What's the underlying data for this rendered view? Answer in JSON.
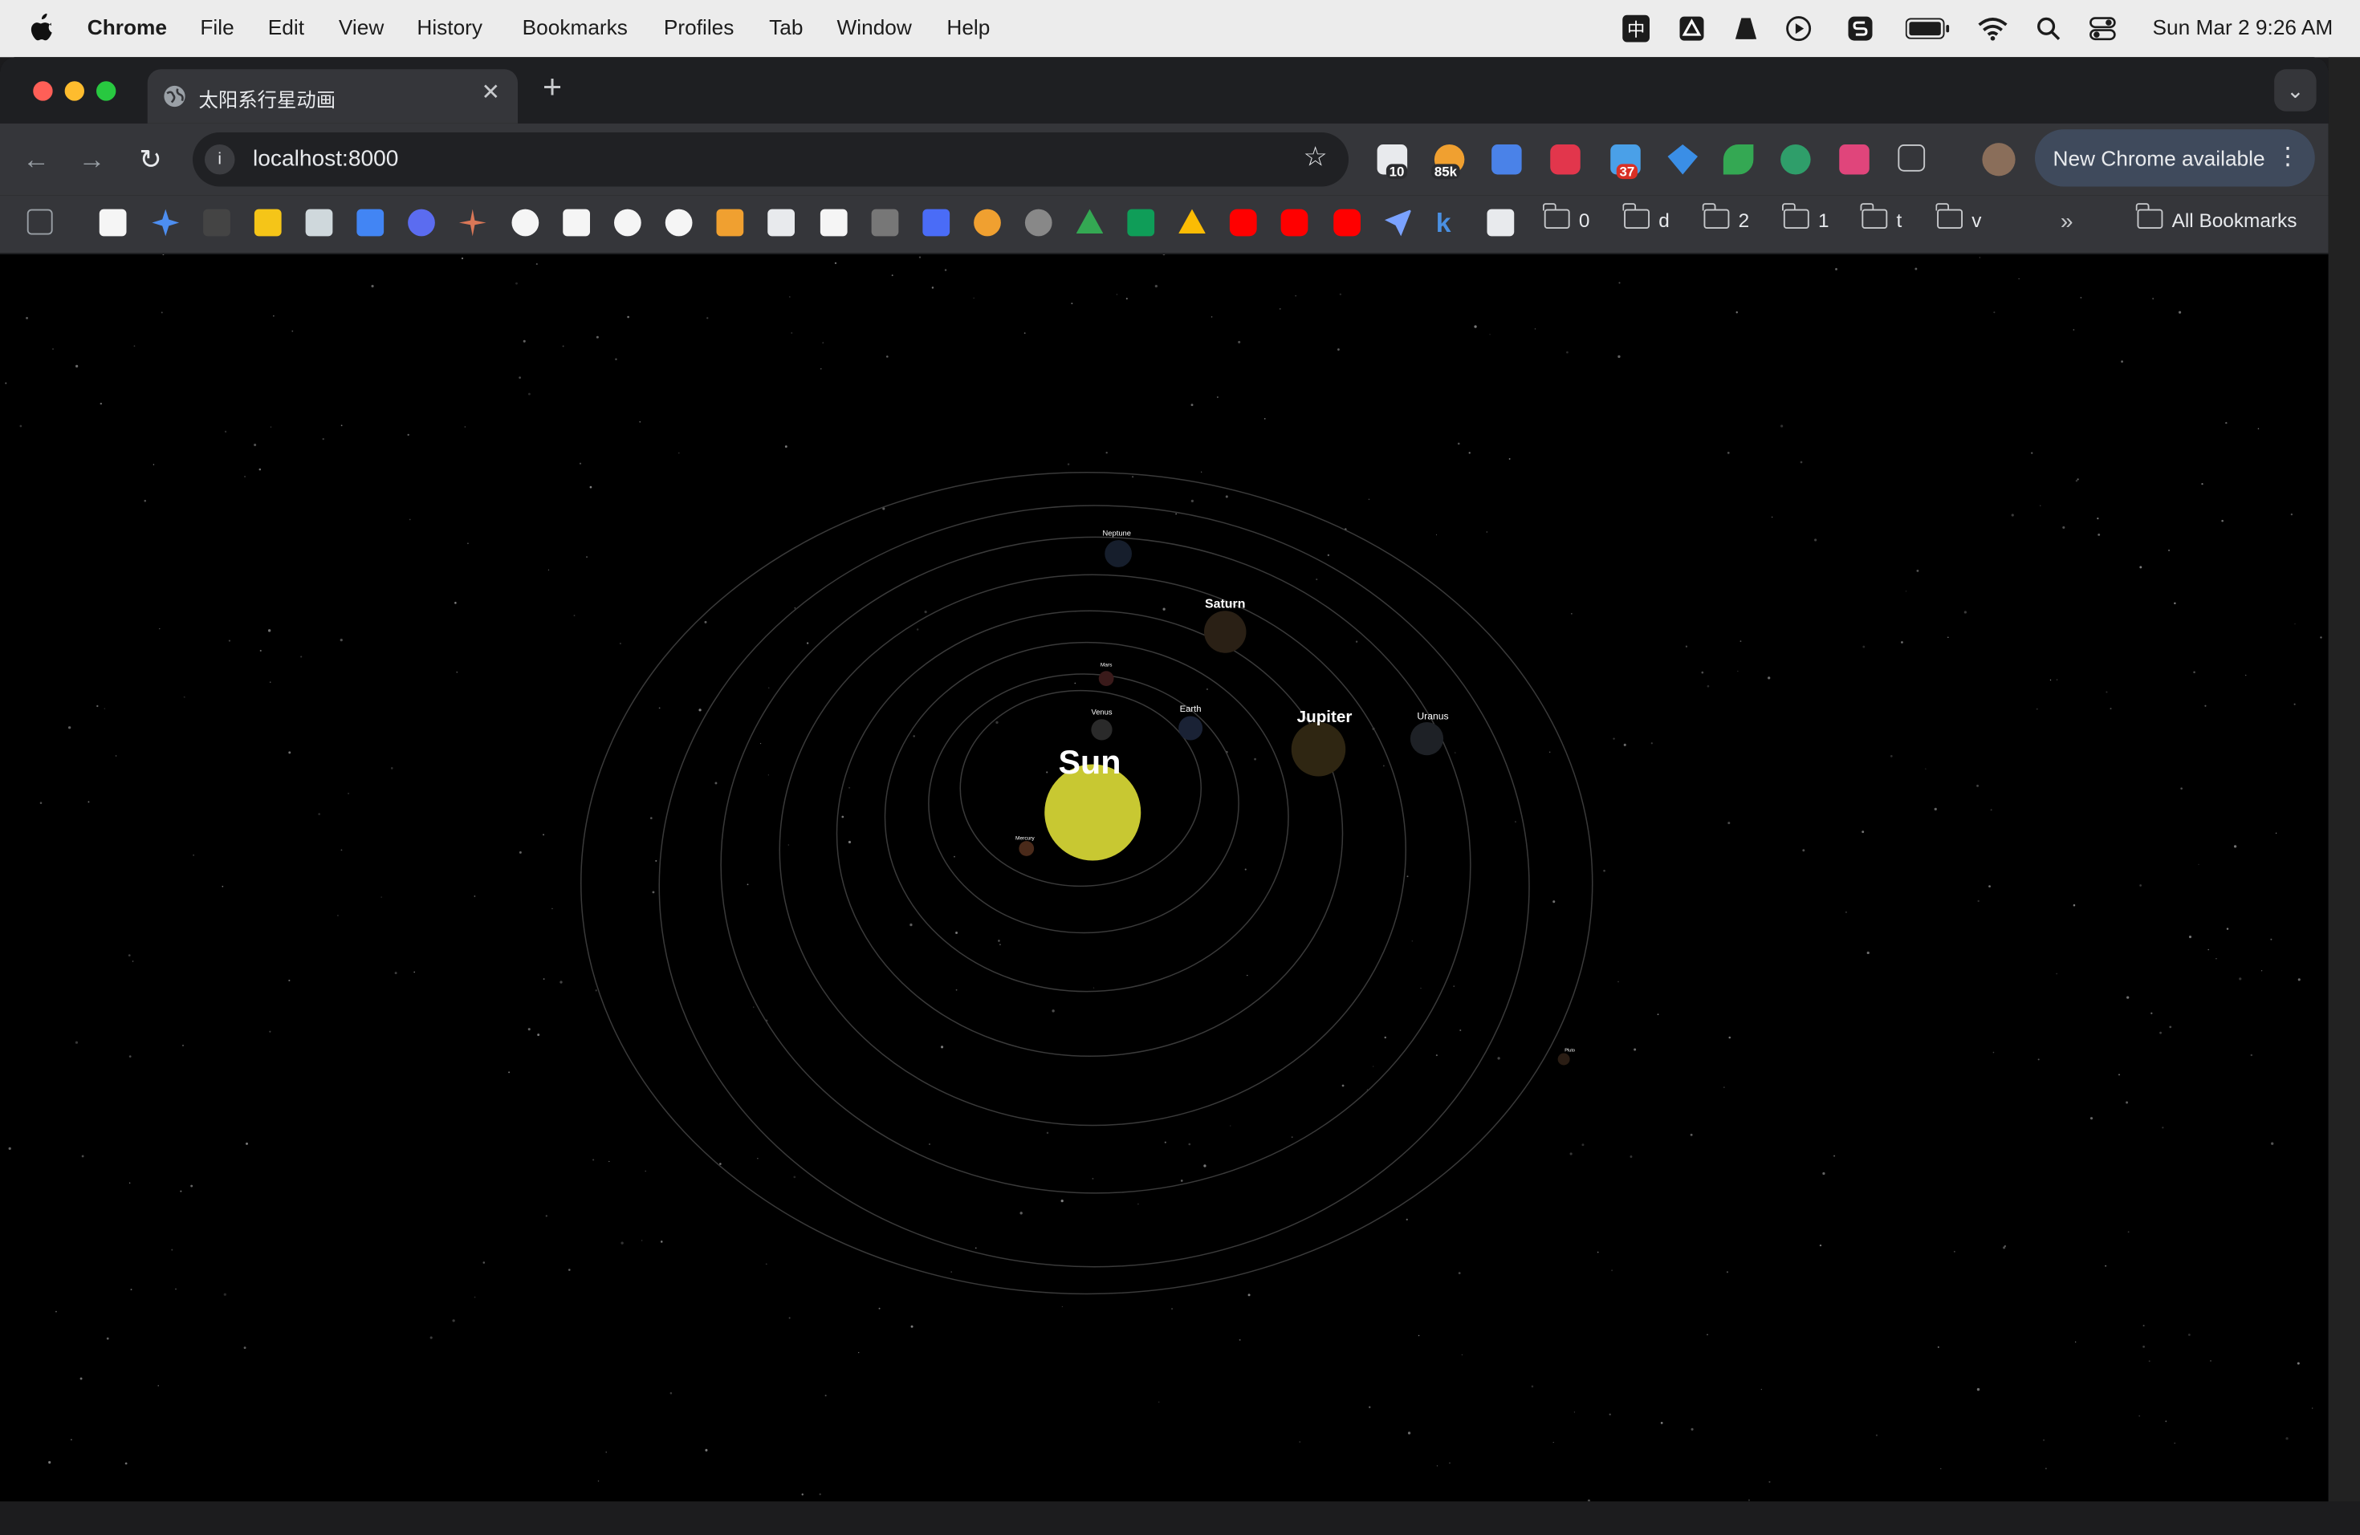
{
  "menubar": {
    "app_name": "Chrome",
    "menus": [
      "File",
      "Edit",
      "View",
      "History",
      "Bookmarks",
      "Profiles",
      "Tab",
      "Window",
      "Help"
    ],
    "status_icons": [
      "input-method-icon",
      "drive-icon",
      "vlc-icon",
      "play-icon",
      "s-app-icon",
      "battery-icon",
      "wifi-icon",
      "spotlight-search-icon",
      "control-center-icon"
    ],
    "clock": "Sun Mar 2  9:26 AM",
    "input_method_glyph": "中"
  },
  "browser": {
    "tab": {
      "title": "太阳系行星动画"
    },
    "address": {
      "url": "localhost:8000"
    },
    "update_button": "New Chrome available",
    "extension_badges": {
      "ext1": "10",
      "ext2": "85k",
      "ext3": "37"
    },
    "bookmark_folders": [
      "0",
      "d",
      "2",
      "1",
      "t",
      "v"
    ],
    "all_bookmarks": "All Bookmarks",
    "colors": {
      "tabstrip": "#1e1f22",
      "toolbar": "#35363a",
      "omnibox": "#202124",
      "update": "#3f4a5c"
    }
  },
  "solar_system": {
    "sun": {
      "label": "Sun",
      "color": "#c8c832"
    },
    "planets": [
      {
        "name": "Mercury",
        "label": "Mercury",
        "color": "#4a2a1a"
      },
      {
        "name": "Venus",
        "label": "Venus",
        "color": "#2a2a2a"
      },
      {
        "name": "Earth",
        "label": "Earth",
        "color": "#1a2235"
      },
      {
        "name": "Mars",
        "label": "Mars",
        "color": "#3a1a1a"
      },
      {
        "name": "Jupiter",
        "label": "Jupiter",
        "color": "#2f2612"
      },
      {
        "name": "Saturn",
        "label": "Saturn",
        "color": "#2a2015"
      },
      {
        "name": "Uranus",
        "label": "Uranus",
        "color": "#1e2126"
      },
      {
        "name": "Neptune",
        "label": "Neptune",
        "color": "#161e2c"
      },
      {
        "name": "Pluto",
        "label": "Pluto",
        "color": "#2a1d14"
      }
    ],
    "orbit_color": "#3a3a3a"
  }
}
